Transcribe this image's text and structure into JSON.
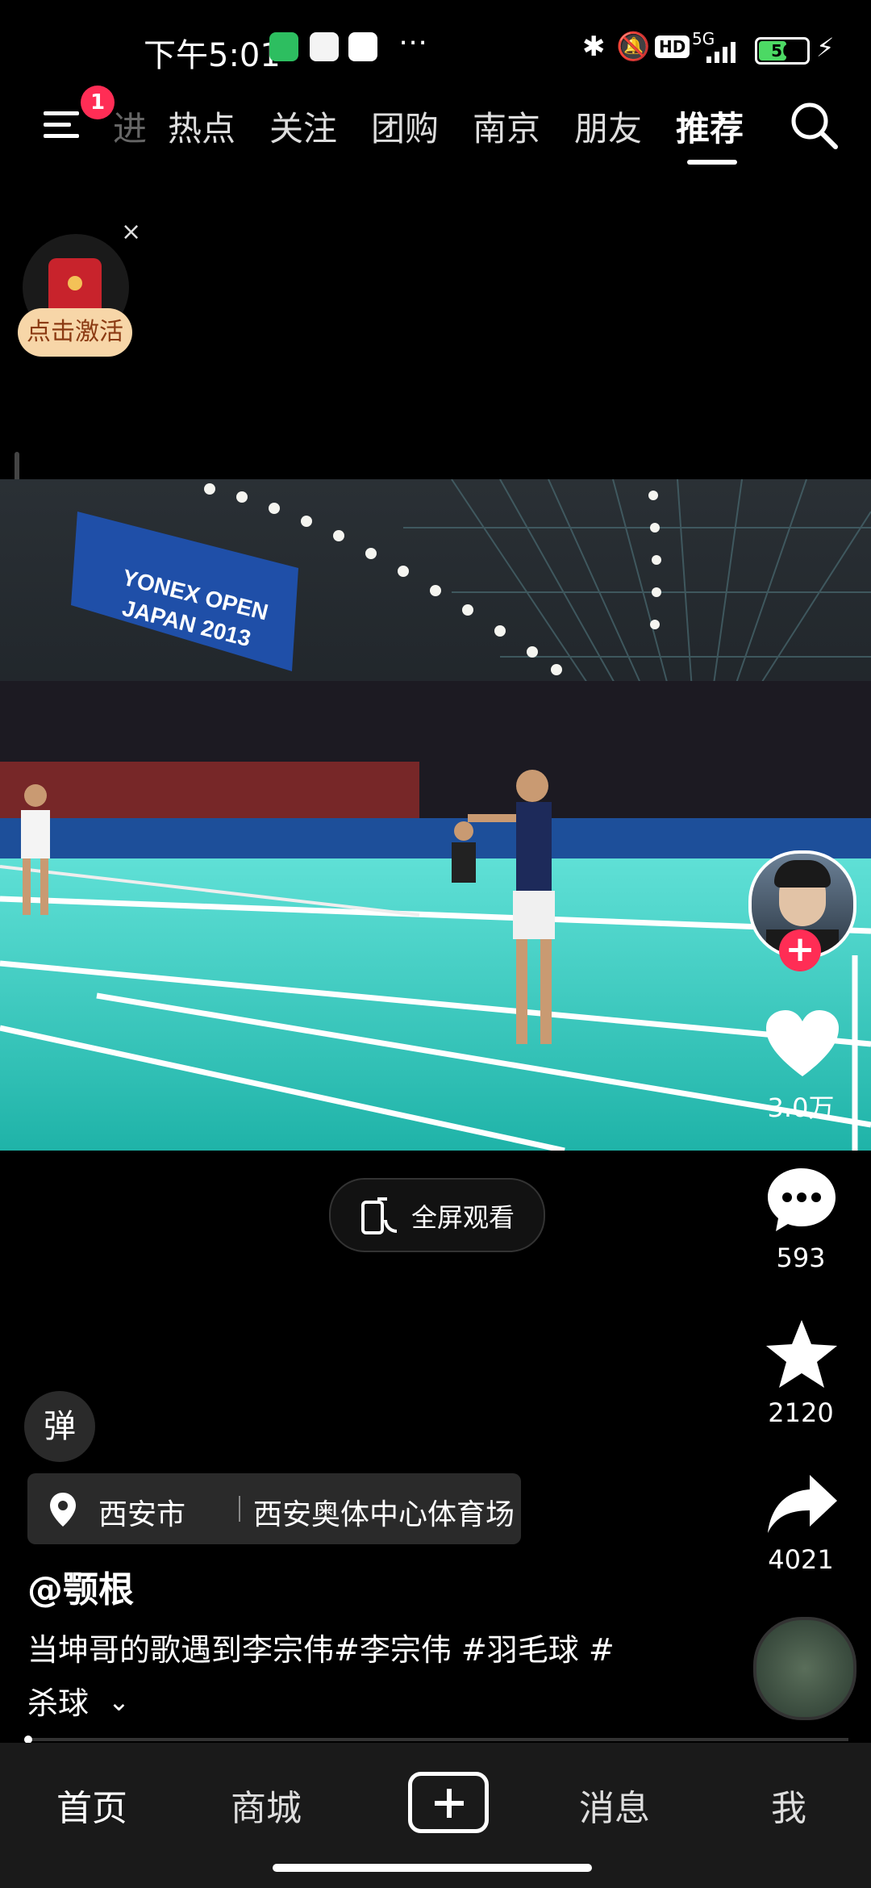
{
  "status": {
    "time": "下午5:01",
    "network": "5G",
    "hd": "HD",
    "battery": "56"
  },
  "tabs": {
    "menu_badge": "1",
    "partial": "进",
    "items": [
      "热点",
      "关注",
      "团购",
      "南京",
      "朋友",
      "推荐"
    ],
    "active_index": 5
  },
  "promo": {
    "label": "点击激活",
    "close": "×"
  },
  "video": {
    "banner_line1": "YONEX OPEN",
    "banner_line2": "JAPAN 2013"
  },
  "fullscreen": {
    "label": "全屏观看"
  },
  "actions": {
    "likes": "3.0万",
    "comments": "593",
    "favorites": "2120",
    "shares": "4021"
  },
  "danmaku": {
    "label": "弹"
  },
  "location": {
    "city": "西安市",
    "place": "西安奥体中心体育场"
  },
  "post": {
    "author": "@颚根",
    "caption_line1": "当坤哥的歌遇到李宗伟#李宗伟 #羽毛球 #",
    "caption_line2": "杀球"
  },
  "nav": {
    "home": "首页",
    "shop": "商城",
    "messages": "消息",
    "me": "我"
  },
  "colors": {
    "court": "#3ccfc2",
    "accent_red": "#ff2d55",
    "promo_bg": "#f7d6a8",
    "nav_bg": "#1a1a1a"
  }
}
